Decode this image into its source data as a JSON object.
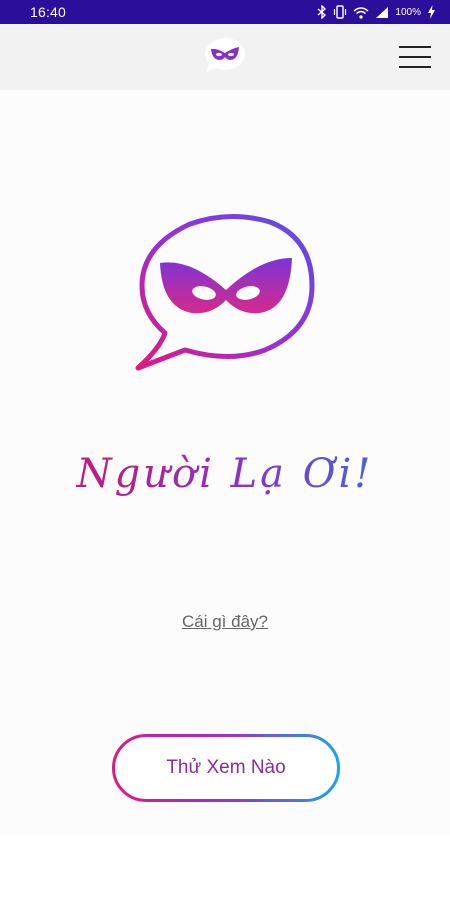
{
  "status_bar": {
    "time": "16:40",
    "battery": "100%",
    "icons": [
      "bluetooth-icon",
      "vibrate-icon",
      "wifi-icon",
      "signal-icon",
      "battery-icon"
    ]
  },
  "app_bar": {
    "logo_icon": "mask-chat-icon",
    "menu_icon": "hamburger-menu-icon"
  },
  "main": {
    "hero_icon": "mask-chat-icon",
    "title": "Người Lạ Ơi!",
    "what_link": "Cái gì đây?",
    "try_button": "Thử Xem Nào"
  },
  "colors": {
    "status_bar": "#2a0f9b",
    "app_bar": "#f2f2f2",
    "gradient_start": "#e0197d",
    "gradient_mid": "#9b2fd6",
    "gradient_end": "#1aa3e8"
  }
}
